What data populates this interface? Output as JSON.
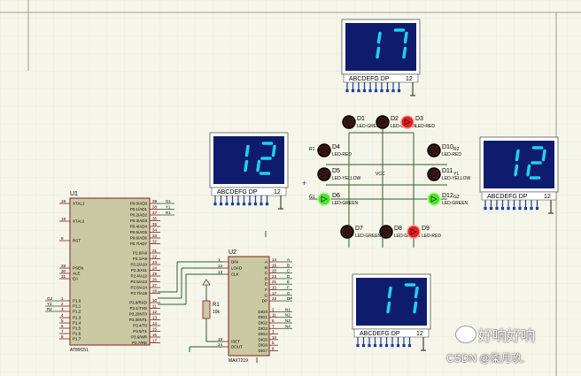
{
  "colors": {
    "background": "#f5f5ea",
    "grid": "#e2e2d2",
    "wire": "#2e5d2e",
    "chip": "#c9c9a4",
    "chip_border": "#8b1a1a",
    "display_bg": "#0f1c6d",
    "segment_on": "#20d0f0",
    "led_red": "#e02020",
    "led_green": "#50e030",
    "led_off": "#3a1414"
  },
  "displays": [
    {
      "id": "top",
      "digits": "17",
      "label": "ABCDEFG DP",
      "num": "12"
    },
    {
      "id": "left",
      "digits": "12",
      "label": "ABCDEFG DP",
      "num": "12"
    },
    {
      "id": "right",
      "digits": "12",
      "label": "ABCDEFG DP",
      "num": "12"
    },
    {
      "id": "bottom",
      "digits": "17",
      "label": "ABCDEFG DP",
      "num": "12"
    }
  ],
  "u1": {
    "ref": "U1",
    "part": "AT89C51",
    "left_pins": [
      {
        "num": "19",
        "name": "XTAL1"
      },
      {
        "num": "18",
        "name": "XTAL2"
      },
      {
        "num": "9",
        "name": "RST"
      },
      {
        "num": "29",
        "name": "PSEN"
      },
      {
        "num": "30",
        "name": "ALE"
      },
      {
        "num": "31",
        "name": "EA"
      },
      {
        "num": "1",
        "name": "P1.0"
      },
      {
        "num": "2",
        "name": "P1.1"
      },
      {
        "num": "3",
        "name": "P1.2"
      },
      {
        "num": "4",
        "name": "P1.3"
      },
      {
        "num": "5",
        "name": "P1.4"
      },
      {
        "num": "6",
        "name": "P1.5"
      },
      {
        "num": "7",
        "name": "P1.6"
      },
      {
        "num": "8",
        "name": "P1.7"
      }
    ],
    "right_pins": [
      {
        "num": "39",
        "name": "P0.0/AD0"
      },
      {
        "num": "38",
        "name": "P0.1/AD1"
      },
      {
        "num": "37",
        "name": "P0.2/AD2"
      },
      {
        "num": "36",
        "name": "P0.3/AD3"
      },
      {
        "num": "35",
        "name": "P0.4/AD4"
      },
      {
        "num": "34",
        "name": "P0.5/AD5"
      },
      {
        "num": "33",
        "name": "P0.6/AD6"
      },
      {
        "num": "32",
        "name": "P0.7/AD7"
      },
      {
        "num": "21",
        "name": "P2.0/A8"
      },
      {
        "num": "22",
        "name": "P2.1/A9"
      },
      {
        "num": "23",
        "name": "P2.2/A10"
      },
      {
        "num": "24",
        "name": "P2.3/A11"
      },
      {
        "num": "25",
        "name": "P2.4/A12"
      },
      {
        "num": "26",
        "name": "P2.5/A13"
      },
      {
        "num": "27",
        "name": "P2.6/A14"
      },
      {
        "num": "28",
        "name": "P2.7/A15"
      },
      {
        "num": "10",
        "name": "P3.0/RXD"
      },
      {
        "num": "11",
        "name": "P3.1/TXD"
      },
      {
        "num": "12",
        "name": "P3.2/INT0"
      },
      {
        "num": "13",
        "name": "P3.3/INT1"
      },
      {
        "num": "14",
        "name": "P3.4/T0"
      },
      {
        "num": "15",
        "name": "P3.5/T1"
      },
      {
        "num": "16",
        "name": "P3.6/WR"
      },
      {
        "num": "17",
        "name": "P3.7/RD"
      }
    ],
    "port0_nets": [
      "G1",
      "Y1",
      "R1"
    ],
    "port1_nets": [
      "G2",
      "Y2",
      "R2"
    ]
  },
  "u2": {
    "ref": "U2",
    "part": "MAX7219",
    "left_pins": [
      {
        "num": "1",
        "name": "DIN"
      },
      {
        "num": "12",
        "name": "LOAD"
      },
      {
        "num": "13",
        "name": "CLK"
      },
      {
        "num": "18",
        "name": "ISET"
      },
      {
        "num": "24",
        "name": "DOUT"
      }
    ],
    "right_pins": [
      {
        "num": "14",
        "name": "A"
      },
      {
        "num": "16",
        "name": "B"
      },
      {
        "num": "20",
        "name": "C"
      },
      {
        "num": "23",
        "name": "D"
      },
      {
        "num": "21",
        "name": "E"
      },
      {
        "num": "15",
        "name": "F"
      },
      {
        "num": "17",
        "name": "G"
      },
      {
        "num": "22",
        "name": "DP"
      },
      {
        "num": "2",
        "name": "DIG0"
      },
      {
        "num": "11",
        "name": "DIG1"
      },
      {
        "num": "6",
        "name": "DIG2"
      },
      {
        "num": "7",
        "name": "DIG3"
      },
      {
        "num": "3",
        "name": "DIG4"
      },
      {
        "num": "10",
        "name": "DIG5"
      },
      {
        "num": "5",
        "name": "DIG6"
      },
      {
        "num": "8",
        "name": "DIG7"
      }
    ],
    "digit_nets": [
      "N1",
      "N2",
      "N3",
      "N4"
    ]
  },
  "r1": {
    "ref": "R1",
    "value": "10k"
  },
  "leds": [
    {
      "ref": "D1",
      "label": "LED-GREEN",
      "lit": false,
      "color": "green"
    },
    {
      "ref": "D2",
      "label": "LED-GREEN",
      "lit": false,
      "color": "green"
    },
    {
      "ref": "D3",
      "label": "LED-RED",
      "lit": true,
      "color": "red"
    },
    {
      "ref": "D4",
      "label": "LED-RED",
      "lit": false,
      "color": "red"
    },
    {
      "ref": "D5",
      "label": "LED-YELLOW",
      "lit": false,
      "color": "yellow"
    },
    {
      "ref": "D6",
      "label": "LED-GREEN",
      "lit": true,
      "color": "green"
    },
    {
      "ref": "D7",
      "label": "LED-GREEN",
      "lit": false,
      "color": "green"
    },
    {
      "ref": "D8",
      "label": "LED-GREEN",
      "lit": false,
      "color": "green"
    },
    {
      "ref": "D9",
      "label": "LED-RED",
      "lit": true,
      "color": "red"
    },
    {
      "ref": "D10",
      "label": "LED-RED",
      "lit": false,
      "color": "red"
    },
    {
      "ref": "D11",
      "label": "LED-YELLOW",
      "lit": false,
      "color": "yellow"
    },
    {
      "ref": "D12",
      "label": "LED-GREEN",
      "lit": true,
      "color": "green"
    }
  ],
  "net_labels": {
    "vcc": "VCC",
    "r1": "R1",
    "y1": "Y1",
    "g1": "G1",
    "r2": "R2",
    "g2": "G2"
  },
  "watermark": {
    "title": "好响好响",
    "subtitle": "CSDN @柒月玖."
  }
}
